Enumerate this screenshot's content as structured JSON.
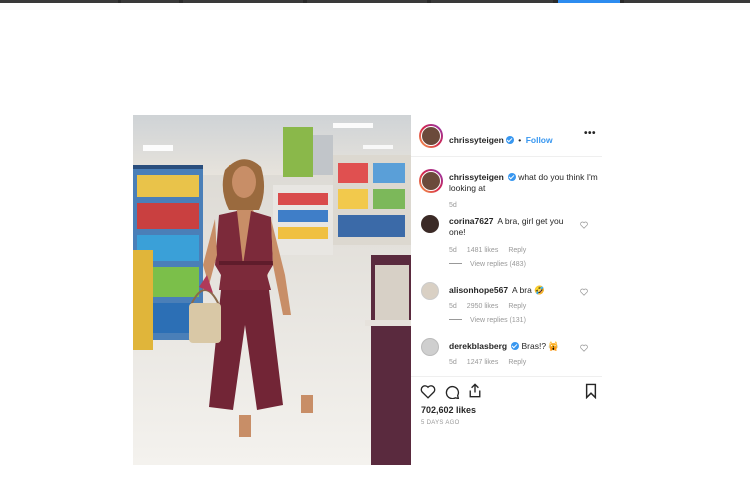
{
  "post": {
    "author": "chrissyteigen",
    "follow_label": "Follow",
    "more_label": "•••",
    "caption_user": "chrissyteigen",
    "caption_text": "what do you think I'm looking at",
    "caption_age": "5d"
  },
  "comments": [
    {
      "user": "corina7627",
      "text": "A bra, girl get you one!",
      "age": "5d",
      "likes": "1481 likes",
      "reply": "Reply",
      "view_replies": "View replies (483)"
    },
    {
      "user": "alisonhope567",
      "text": "A bra 🤣",
      "age": "5d",
      "likes": "2950 likes",
      "reply": "Reply",
      "view_replies": "View replies (131)"
    },
    {
      "user": "derekblasberg",
      "text": "Bras!? 🙀",
      "age": "5d",
      "likes": "1247 likes",
      "reply": "Reply"
    }
  ],
  "footer": {
    "likes": "702,602 likes",
    "time": "5 DAYS AGO"
  },
  "icons": [
    "more-options-icon",
    "like-heart-icon",
    "comment-icon",
    "share-icon",
    "save-bookmark-icon",
    "verified-badge-icon"
  ],
  "colors": {
    "accent": "#3897f0",
    "muted": "#999999",
    "text": "#262626"
  }
}
